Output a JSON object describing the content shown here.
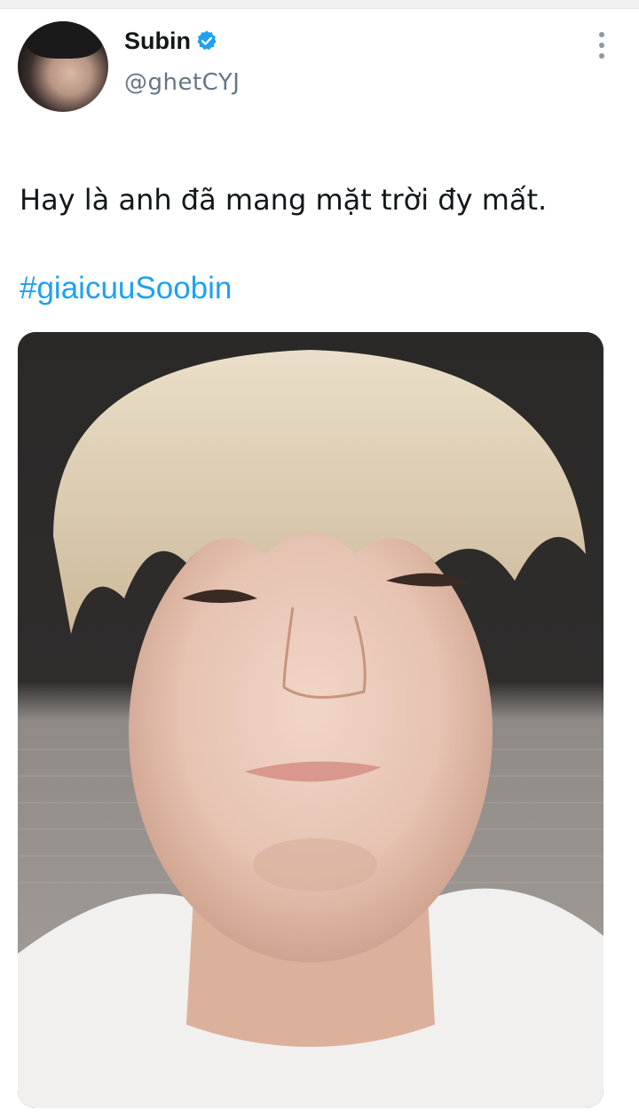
{
  "tweet": {
    "author": {
      "display_name": "Subin",
      "handle": "@ghetCYJ",
      "verified": true,
      "avatar_icon": "profile-photo"
    },
    "text_line": "Hay là anh đã mang mặt trời đy mất.",
    "hashtag": "#giaicuuSoobin",
    "media": {
      "type": "photo",
      "icon": "selfie-photo"
    },
    "menu_icon": "more-options-icon"
  },
  "colors": {
    "text": "#14171a",
    "secondary": "#657786",
    "hashtag": "#1da1f2",
    "verified": "#1da1f2"
  }
}
